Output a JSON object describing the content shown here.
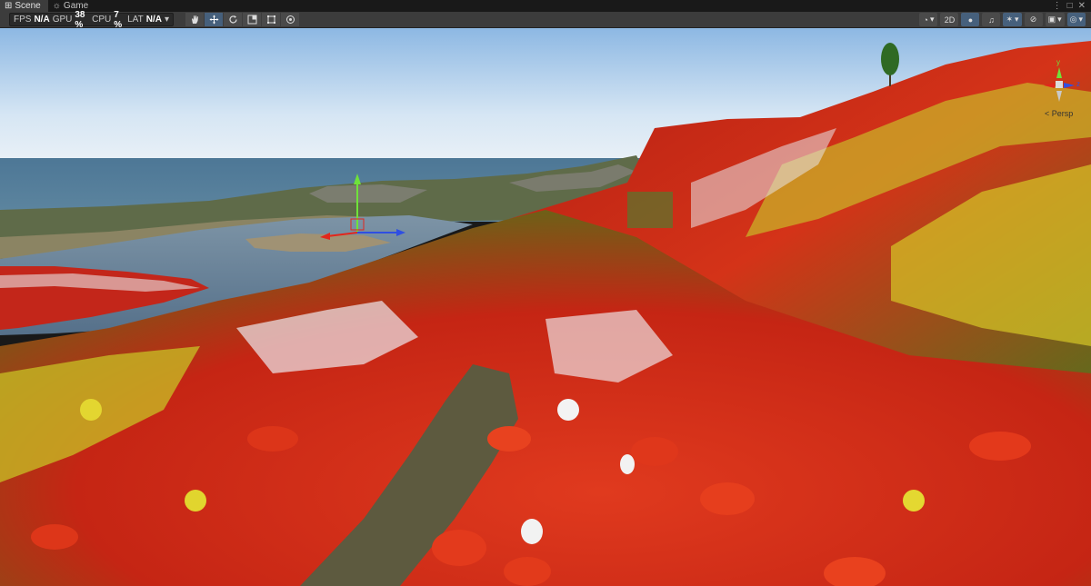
{
  "tabs": [
    {
      "label": "Scene",
      "icon": "grid-icon",
      "active": true
    },
    {
      "label": "Game",
      "icon": "gamepad-icon",
      "active": false
    }
  ],
  "stats": {
    "fps_label": "FPS",
    "fps_value": "N/A",
    "gpu_label": "GPU",
    "gpu_value": "38 %",
    "cpu_label": "CPU",
    "cpu_value": "7 %",
    "lat_label": "LAT",
    "lat_value": "N/A"
  },
  "tools": [
    "hand-tool-icon",
    "move-tool-icon",
    "rotate-tool-icon",
    "scale-tool-icon",
    "rect-tool-icon",
    "transform-tool-icon"
  ],
  "right_toolbar": {
    "two_d_label": "2D",
    "persp_label": "< Persp"
  },
  "gizmo_axes": {
    "y": "y",
    "z": "z"
  },
  "colors": {
    "toolbar_bg": "#3c3c3c",
    "selected_tool": "#46607c",
    "sky_top": "#9bbfe5",
    "sea": "#3f6a8a"
  }
}
